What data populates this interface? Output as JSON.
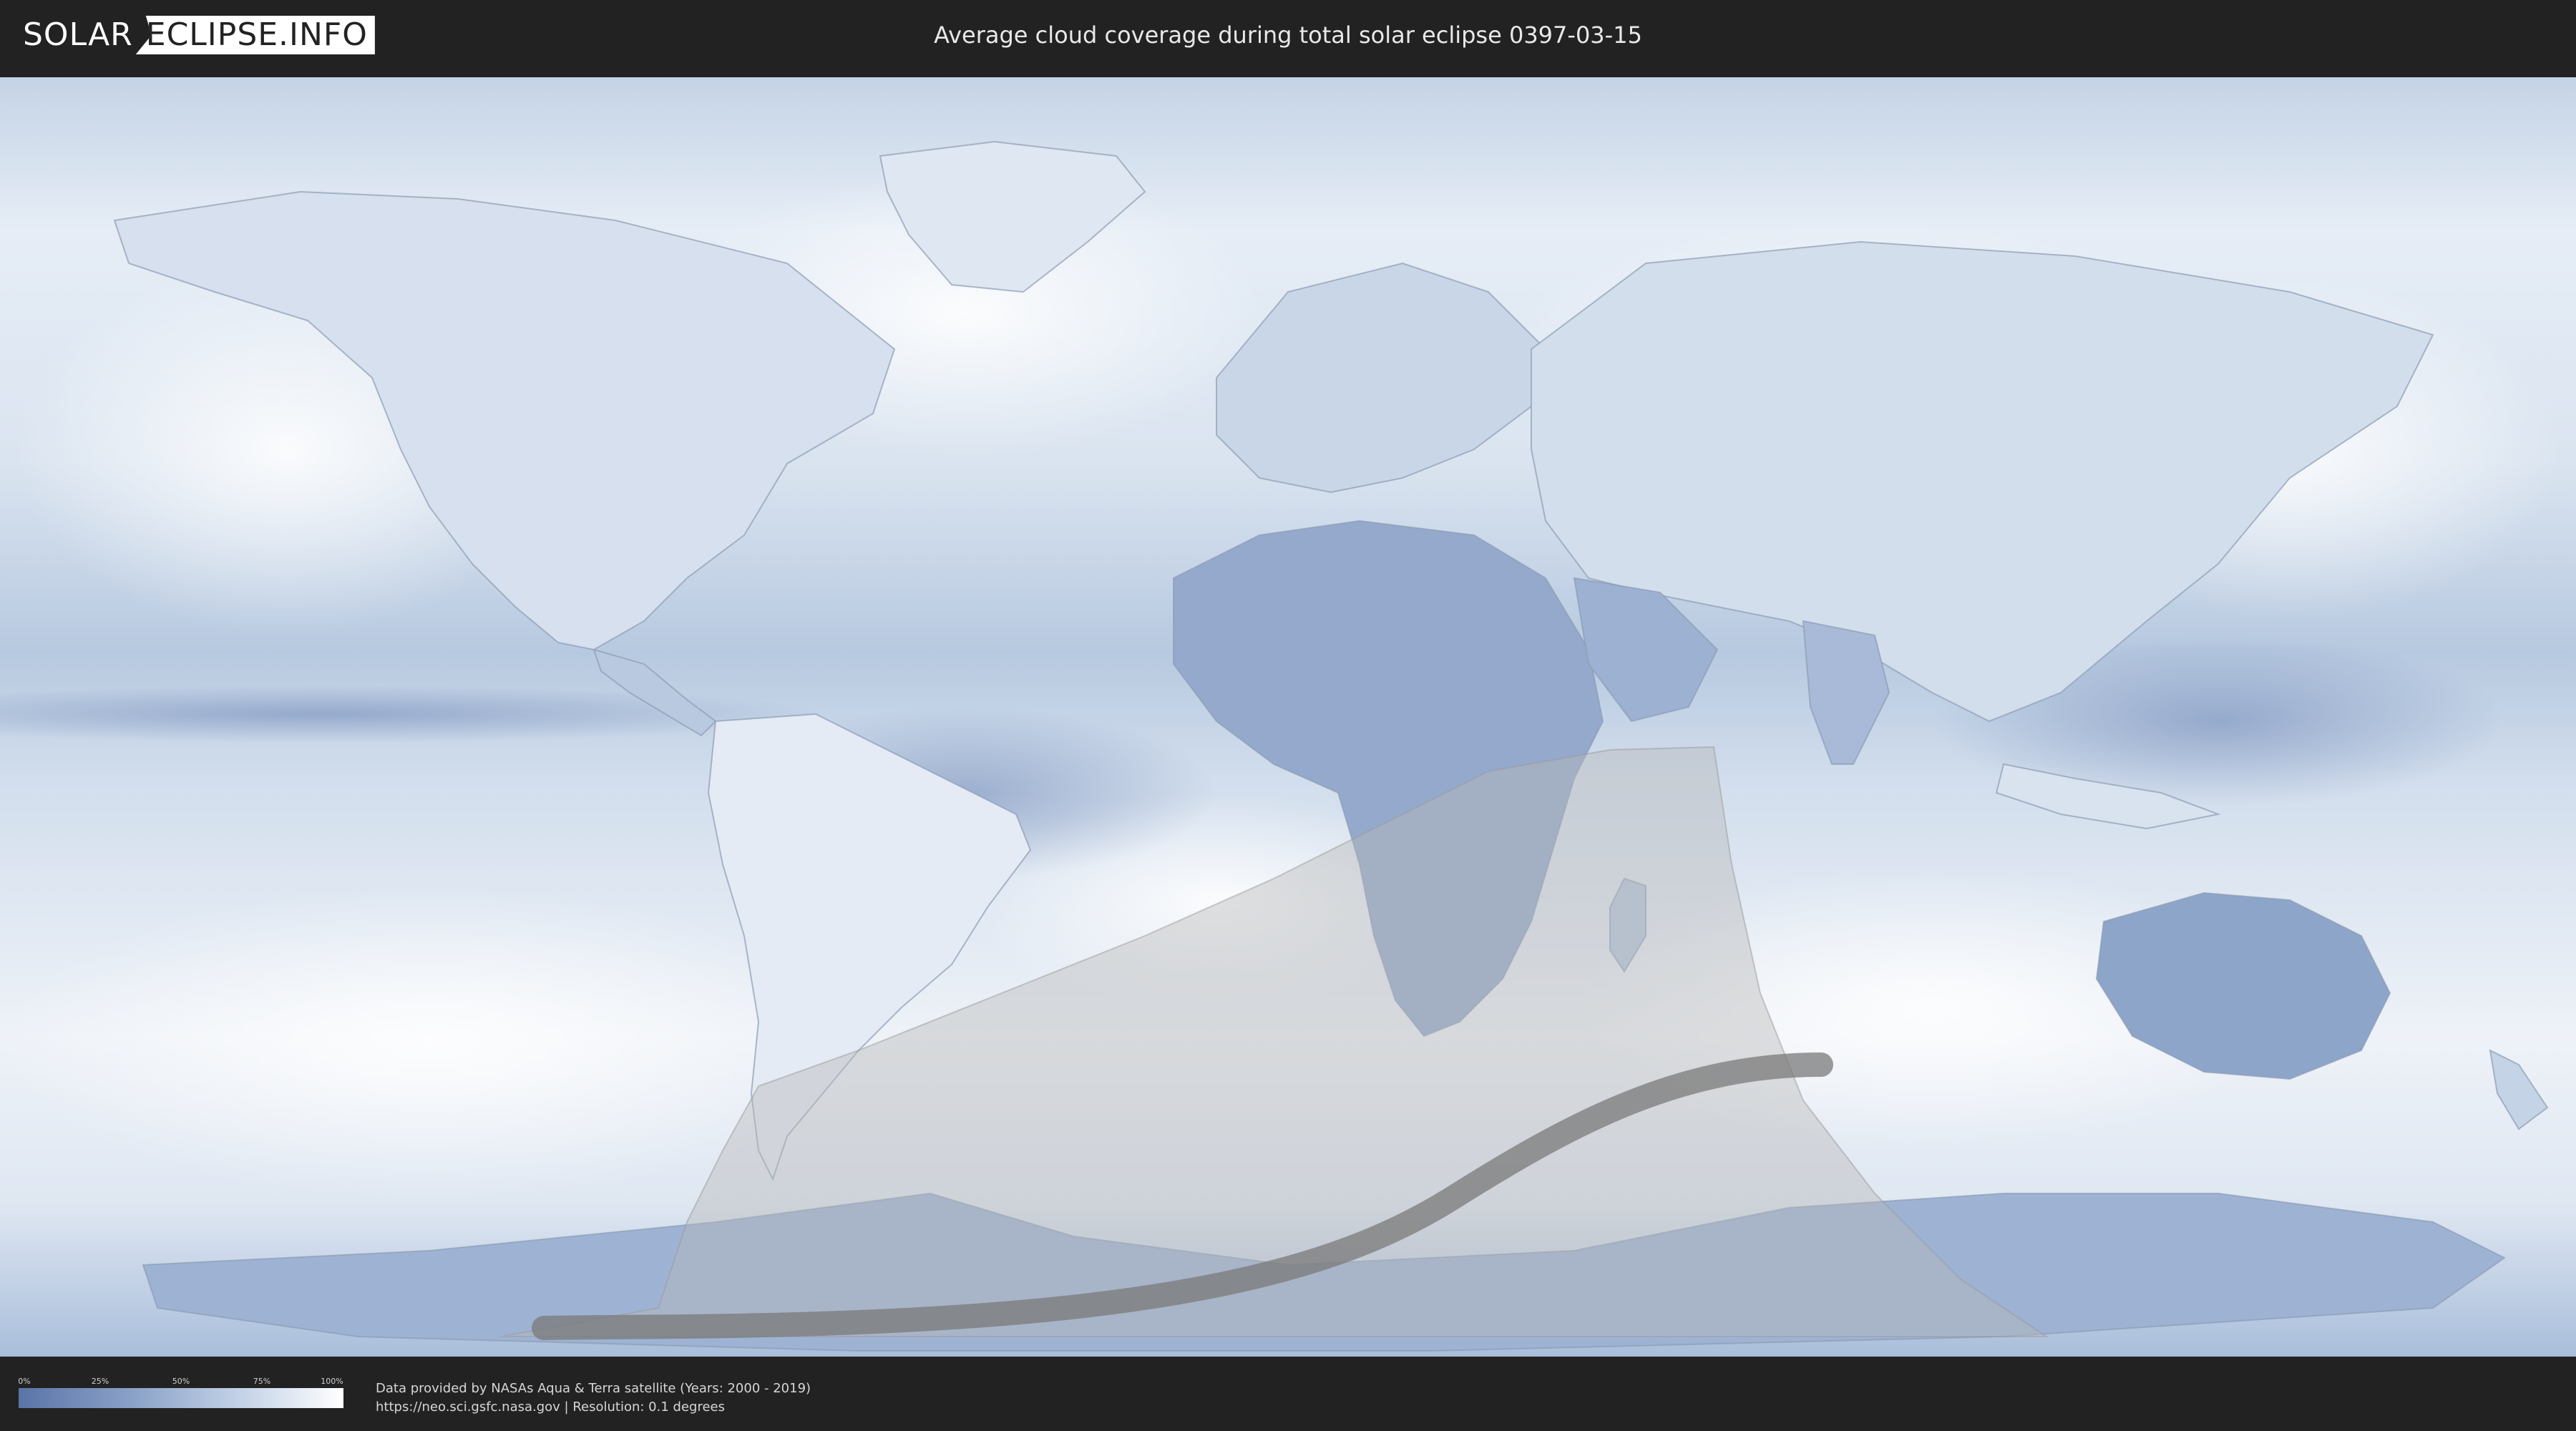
{
  "header": {
    "logo_left": "SOLAR",
    "logo_right": "ECLIPSE.INFO",
    "title": "Average cloud coverage during total solar eclipse 0397-03-15"
  },
  "map": {
    "colors": {
      "clear": "#5a74a8",
      "cloudy": "#ffffff",
      "penumbra_shade": "#b8b8b8",
      "totality_path": "#7a7a7a"
    }
  },
  "legend": {
    "ticks": [
      "0%",
      "25%",
      "50%",
      "75%",
      "100%"
    ]
  },
  "footer": {
    "credit_line_1": "Data provided by NASAs Aqua & Terra satellite (Years: 2000 - 2019)",
    "credit_line_2": "https://neo.sci.gsfc.nasa.gov | Resolution: 0.1 degrees"
  }
}
